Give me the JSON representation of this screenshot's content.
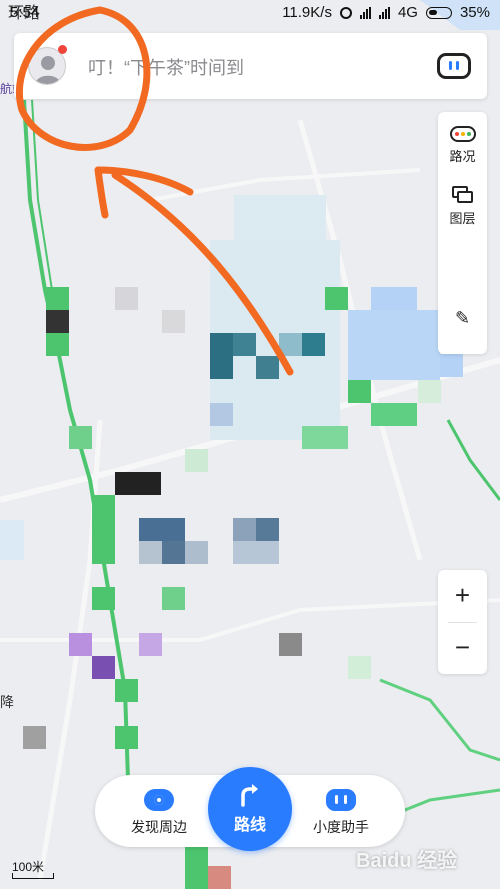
{
  "status_bar": {
    "time": "5:54",
    "network_speed": "11.9K/s",
    "network_type": "4G",
    "battery": "35%"
  },
  "search": {
    "placeholder": "叮！“下午茶”时间到"
  },
  "tools": {
    "traffic_label": "路况",
    "layers_label": "图层"
  },
  "zoom": {
    "in_label": "+",
    "out_label": "−"
  },
  "bottom_bar": {
    "discover_label": "发现周边",
    "route_label": "路线",
    "assistant_label": "小度助手"
  },
  "scale": {
    "label": "100米"
  },
  "map_labels": {
    "top_left": "环路",
    "left_mid": "降",
    "left_small": "航站"
  },
  "watermark": "Baidu 经验",
  "colors": {
    "accent": "#2a7cff",
    "annotation": "#f26a21",
    "road_green": "#4cc56e"
  }
}
